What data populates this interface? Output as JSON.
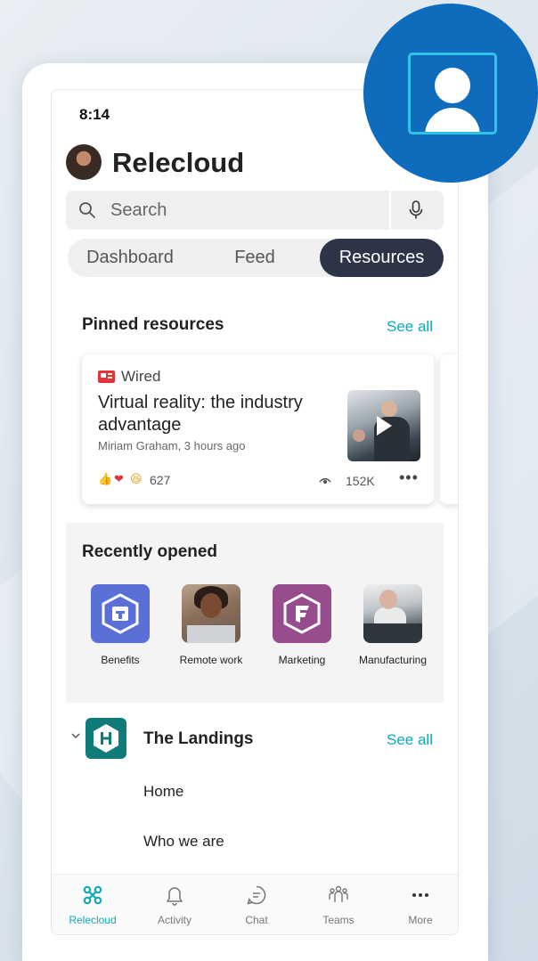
{
  "status_bar": {
    "time": "8:14"
  },
  "header": {
    "title": "Relecloud"
  },
  "search": {
    "placeholder": "Search"
  },
  "tabs": [
    {
      "label": "Dashboard",
      "active": false
    },
    {
      "label": "Feed",
      "active": false
    },
    {
      "label": "Resources",
      "active": true
    }
  ],
  "pinned": {
    "title": "Pinned resources",
    "see_all": "See all",
    "card": {
      "source": "Wired",
      "headline": "Virtual reality: the industry advantage",
      "byline": "Miriam Graham, 3 hours ago",
      "reaction_count": "627",
      "views": "152K",
      "more": "•••"
    }
  },
  "recent": {
    "title": "Recently opened",
    "items": [
      {
        "label": "Benefits",
        "icon": "hexagon-logo-icon"
      },
      {
        "label": "Remote work",
        "icon": "photo"
      },
      {
        "label": "Marketing",
        "icon": "hexagon-logo-icon"
      },
      {
        "label": "Manufacturing",
        "icon": "photo"
      }
    ]
  },
  "landings": {
    "title": "The Landings",
    "see_all": "See all",
    "links": [
      "Home",
      "Who we are"
    ]
  },
  "bottom_nav": [
    {
      "label": "Relecloud",
      "icon": "relecloud-icon",
      "active": true
    },
    {
      "label": "Activity",
      "icon": "bell-icon",
      "active": false
    },
    {
      "label": "Chat",
      "icon": "chat-icon",
      "active": false
    },
    {
      "label": "Teams",
      "icon": "teams-icon",
      "active": false
    },
    {
      "label": "More",
      "icon": "more-icon",
      "active": false
    }
  ],
  "colors": {
    "accent": "#12a7b9",
    "active_tab": "#2e3447",
    "badge_blue": "#0f6cbd",
    "benefits": "#5b6fd9",
    "marketing": "#974c8e",
    "landings": "#107c7a"
  }
}
